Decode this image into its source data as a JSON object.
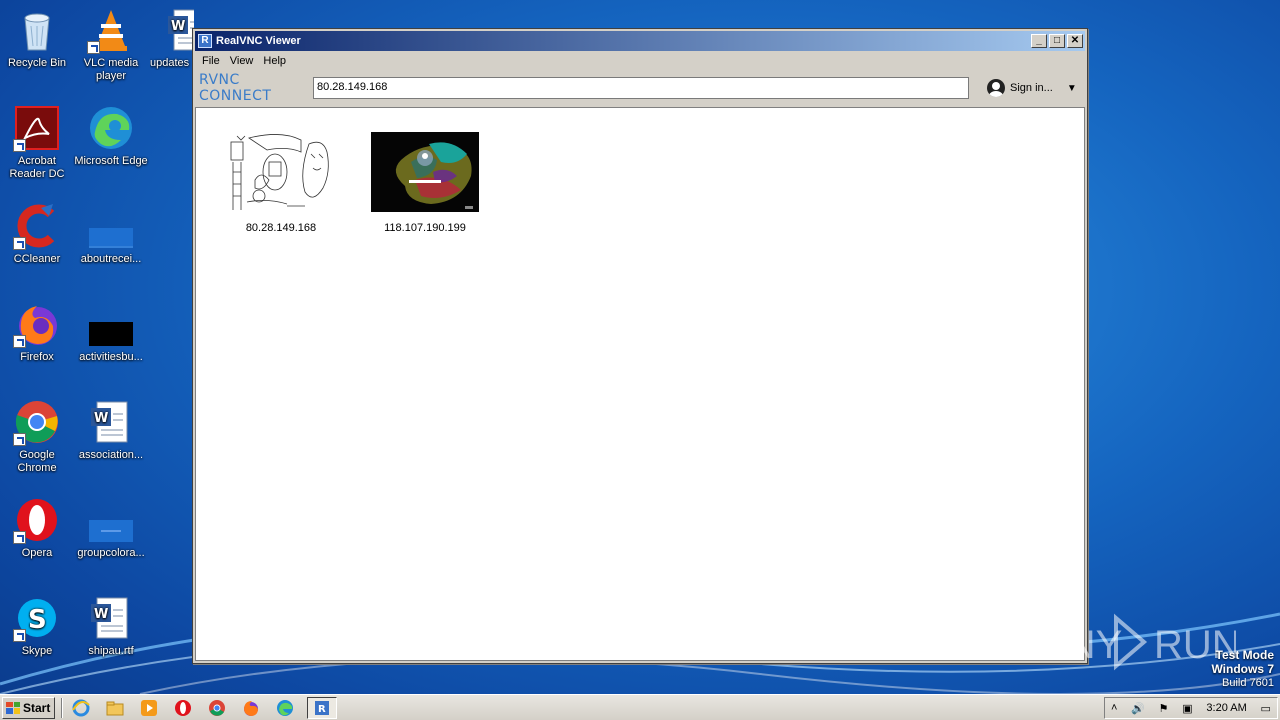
{
  "desktop": {
    "icons": [
      {
        "label": "Recycle Bin",
        "icon": "recycle-bin-icon"
      },
      {
        "label": "VLC media player",
        "icon": "vlc-icon"
      },
      {
        "label": "updates",
        "icon": "word-doc-icon"
      },
      {
        "label": "Acrobat Reader DC",
        "icon": "acrobat-icon"
      },
      {
        "label": "Microsoft Edge",
        "icon": "edge-icon"
      },
      {
        "label": "CCleaner",
        "icon": "ccleaner-icon"
      },
      {
        "label": "aboutrecei...",
        "icon": "blank-file-icon"
      },
      {
        "label": "Firefox",
        "icon": "firefox-icon"
      },
      {
        "label": "activitiesbu...",
        "icon": "black-file-icon"
      },
      {
        "label": "Google Chrome",
        "icon": "chrome-icon"
      },
      {
        "label": "association...",
        "icon": "word-doc-icon"
      },
      {
        "label": "Opera",
        "icon": "opera-icon"
      },
      {
        "label": "groupcolora...",
        "icon": "blank-file-icon"
      },
      {
        "label": "Skype",
        "icon": "skype-icon"
      },
      {
        "label": "shipau.rtf",
        "icon": "word-doc-icon"
      }
    ]
  },
  "window": {
    "title": "RealVNC Viewer",
    "app_icon_glyph": "R",
    "controls": {
      "minimize": "_",
      "maximize": "□",
      "close": "✕"
    },
    "menu": [
      "File",
      "View",
      "Help"
    ],
    "logo": "RVNC CONNECT",
    "address_value": "80.28.149.168",
    "signin_label": "Sign in...",
    "caret": "▼",
    "connections": [
      {
        "label": "80.28.149.168",
        "preview": "sketch"
      },
      {
        "label": "118.107.190.199",
        "preview": "lockscreen"
      }
    ]
  },
  "taskbar": {
    "start_label": "Start",
    "pinned": [
      "ie-icon",
      "explorer-icon",
      "media-player-icon",
      "opera-icon",
      "chrome-icon",
      "firefox-icon",
      "edge-icon",
      "realvnc-icon"
    ],
    "clock": "3:20 AM"
  },
  "watermark": {
    "text": "ANY RUN"
  },
  "os_notice": {
    "line1": "Test Mode",
    "line2": "Windows 7",
    "line3": "Build 7601"
  }
}
